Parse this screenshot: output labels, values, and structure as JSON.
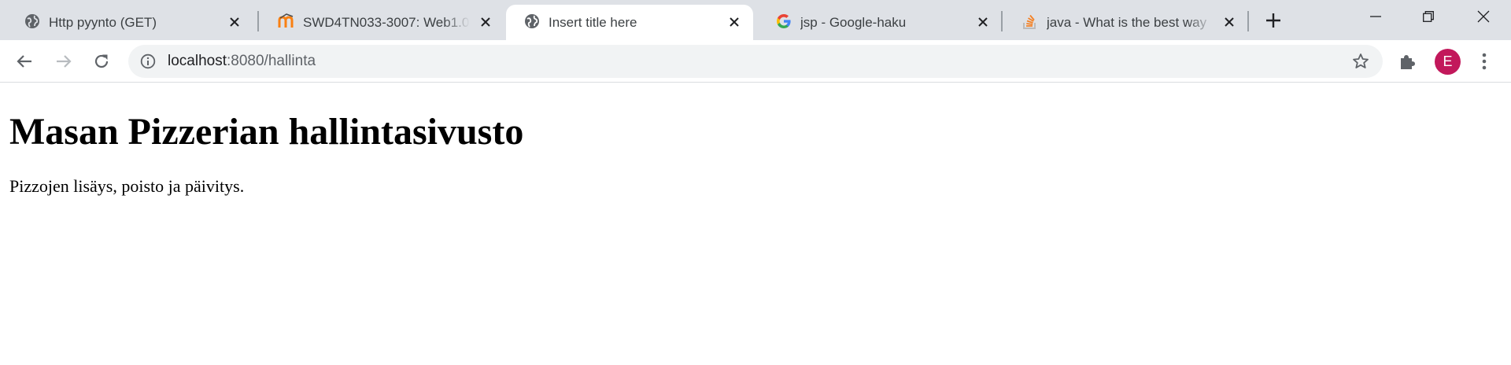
{
  "browser": {
    "tabs": [
      {
        "title": "Http pyynto (GET)",
        "favicon": "globe-icon",
        "active": false
      },
      {
        "title": "SWD4TN033-3007: Web1.0",
        "favicon": "moodle-icon",
        "active": false
      },
      {
        "title": "Insert title here",
        "favicon": "globe-icon",
        "active": true
      },
      {
        "title": "jsp - Google-haku",
        "favicon": "google-icon",
        "active": false
      },
      {
        "title": "java - What is the best way",
        "favicon": "stackoverflow-icon",
        "active": false
      }
    ],
    "address": {
      "host": "localhost",
      "path": ":8080/hallinta"
    },
    "profile_initial": "E",
    "colors": {
      "tabstrip": "#dee1e6",
      "omnibox": "#f1f3f4",
      "avatar": "#c2185b",
      "moodle_orange": "#f98012",
      "stackoverflow_orange": "#f48024"
    }
  },
  "page": {
    "heading": "Masan Pizzerian hallintasivusto",
    "paragraph": "Pizzojen lisäys, poisto ja päivitys."
  }
}
